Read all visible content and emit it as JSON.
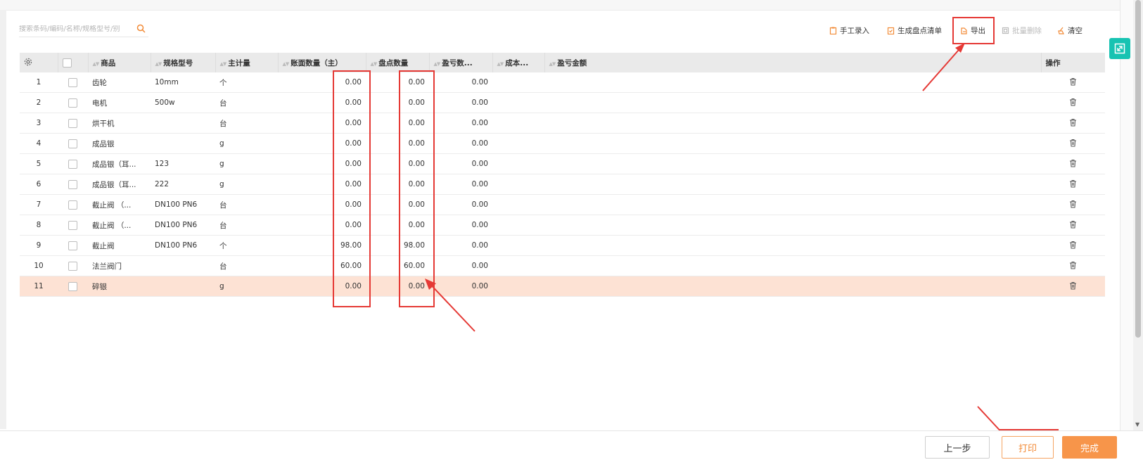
{
  "search": {
    "placeholder": "搜索条码/编码/名称/规格型号/别",
    "icon": "search-icon"
  },
  "toolbar": {
    "manual_entry": "手工录入",
    "generate_list": "生成盘点清单",
    "export": "导出",
    "batch_delete": "批量删除",
    "clear": "清空"
  },
  "table": {
    "columns": {
      "product": "商品",
      "spec": "规格型号",
      "unit": "主计量",
      "book_qty": "账面数量（主）",
      "count_qty": "盘点数量",
      "diff_qty": "盈亏数...",
      "cost": "成本...",
      "diff_amount": "盈亏金额",
      "action": "操作"
    },
    "rows": [
      {
        "no": "1",
        "product": "齿轮",
        "spec": "10mm",
        "unit": "个",
        "book_qty": "0.00",
        "count_qty": "0.00",
        "diff_qty": "0.00"
      },
      {
        "no": "2",
        "product": "电机",
        "spec": "500w",
        "unit": "台",
        "book_qty": "0.00",
        "count_qty": "0.00",
        "diff_qty": "0.00"
      },
      {
        "no": "3",
        "product": "烘干机",
        "spec": "",
        "unit": "台",
        "book_qty": "0.00",
        "count_qty": "0.00",
        "diff_qty": "0.00"
      },
      {
        "no": "4",
        "product": "成品银",
        "spec": "",
        "unit": "g",
        "book_qty": "0.00",
        "count_qty": "0.00",
        "diff_qty": "0.00"
      },
      {
        "no": "5",
        "product": "成品银（耳...",
        "spec": "123",
        "unit": "g",
        "book_qty": "0.00",
        "count_qty": "0.00",
        "diff_qty": "0.00"
      },
      {
        "no": "6",
        "product": "成品银（耳...",
        "spec": "222",
        "unit": "g",
        "book_qty": "0.00",
        "count_qty": "0.00",
        "diff_qty": "0.00"
      },
      {
        "no": "7",
        "product": "截止阀 （...",
        "spec": "DN100 PN6",
        "unit": "台",
        "book_qty": "0.00",
        "count_qty": "0.00",
        "diff_qty": "0.00"
      },
      {
        "no": "8",
        "product": "截止阀 （...",
        "spec": "DN100 PN6",
        "unit": "台",
        "book_qty": "0.00",
        "count_qty": "0.00",
        "diff_qty": "0.00"
      },
      {
        "no": "9",
        "product": "截止阀",
        "spec": "DN100 PN6",
        "unit": "个",
        "book_qty": "98.00",
        "count_qty": "98.00",
        "diff_qty": "0.00"
      },
      {
        "no": "10",
        "product": "法兰阀门",
        "spec": "",
        "unit": "台",
        "book_qty": "60.00",
        "count_qty": "60.00",
        "diff_qty": "0.00"
      },
      {
        "no": "11",
        "product": "碎银",
        "spec": "",
        "unit": "g",
        "book_qty": "0.00",
        "count_qty": "0.00",
        "diff_qty": "0.00",
        "highlighted": true
      }
    ]
  },
  "footer": {
    "prev": "上一步",
    "print": "打印",
    "done": "完成"
  },
  "colors": {
    "accent": "#f7954a",
    "annotation": "#e53935",
    "teal": "#17c3b2",
    "highlight_row": "#fde2d4"
  }
}
